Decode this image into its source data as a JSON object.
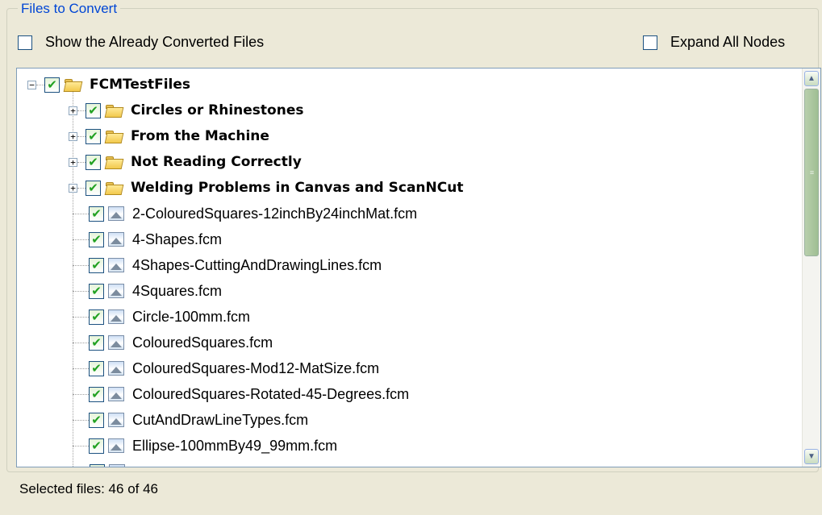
{
  "group_title": "Files to Convert",
  "options": {
    "show_converted": "Show the Already Converted Files",
    "expand_all": "Expand All Nodes"
  },
  "tree": {
    "root": "FCMTestFiles",
    "folders": [
      "Circles or Rhinestones",
      "From the Machine",
      "Not Reading Correctly",
      "Welding Problems in Canvas and ScanNCut"
    ],
    "files": [
      "2-ColouredSquares-12inchBy24inchMat.fcm",
      "4-Shapes.fcm",
      "4Shapes-CuttingAndDrawingLines.fcm",
      "4Squares.fcm",
      "Circle-100mm.fcm",
      "ColouredSquares.fcm",
      "ColouredSquares-Mod12-MatSize.fcm",
      "ColouredSquares-Rotated-45-Degrees.fcm",
      "CutAndDrawLineTypes.fcm",
      "Ellipse-100mmBy49_99mm.fcm"
    ],
    "icons": {
      "expand": "plus-icon",
      "collapse": "minus-icon",
      "folder": "folder-icon",
      "file": "image-file-icon",
      "check": "checkmark-icon"
    }
  },
  "status": "Selected files: 46 of 46",
  "colors": {
    "background": "#ece9d8",
    "group_title": "#0046d5",
    "check": "#21a121",
    "scroll_thumb": "#a9c79a"
  }
}
